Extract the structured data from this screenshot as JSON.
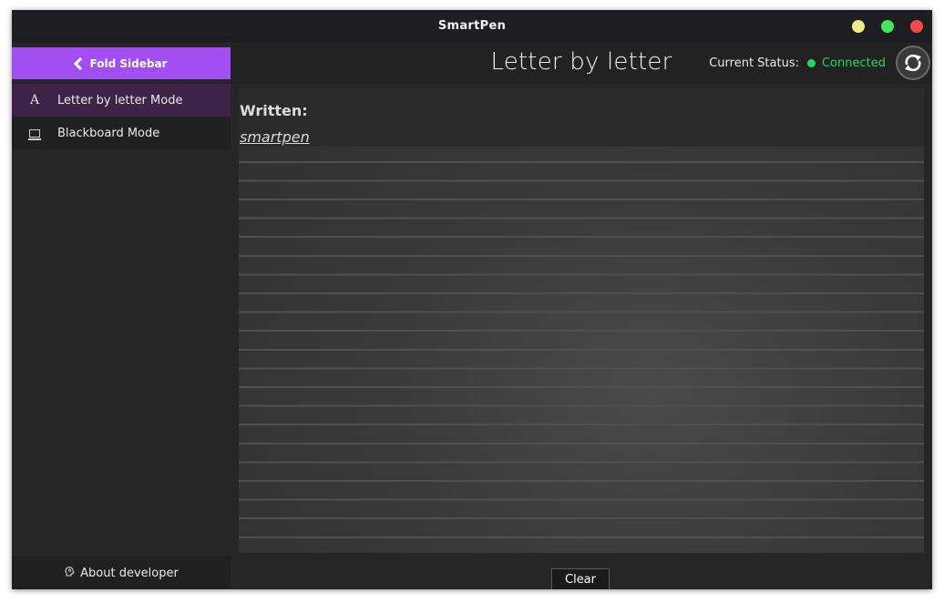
{
  "window": {
    "title": "SmartPen",
    "controls": {
      "minimize_color": "#f1ec8b",
      "maximize_color": "#46e45c",
      "close_color": "#f14b4b"
    }
  },
  "colors": {
    "accent": "#a24ef2",
    "active_item_bg": "#3c2347",
    "status_connected": "#22d961"
  },
  "sidebar": {
    "fold_label": "Fold Sidebar",
    "items": [
      {
        "label": "Letter by letter Mode",
        "icon": "letter-a-icon",
        "glyph": "A",
        "active": true
      },
      {
        "label": "Blackboard Mode",
        "icon": "monitor-icon",
        "active": false
      }
    ],
    "about_label": "About developer",
    "about_icon": "head-icon"
  },
  "main": {
    "page_title": "Letter by letter",
    "status_label": "Current Status:",
    "status_value": "Connected",
    "refresh_icon": "refresh-icon",
    "written_label": "Written:",
    "written_text": "smartpen",
    "clear_label": "Clear"
  }
}
